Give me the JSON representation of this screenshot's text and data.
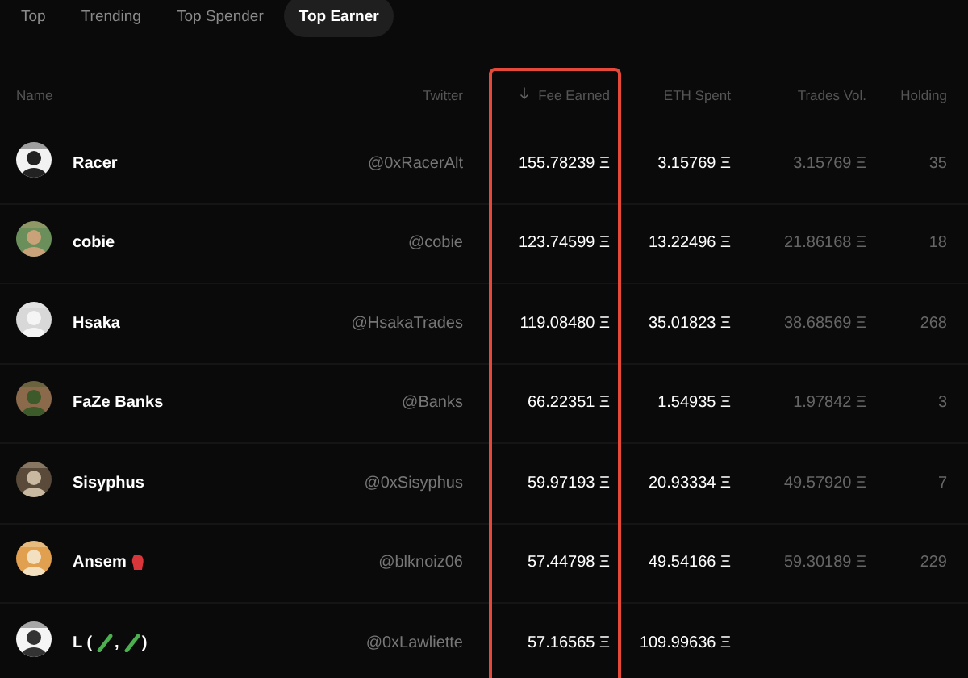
{
  "tabs": [
    {
      "label": "Top",
      "selected": false
    },
    {
      "label": "Trending",
      "selected": false
    },
    {
      "label": "Top Spender",
      "selected": false
    },
    {
      "label": "Top Earner",
      "selected": true
    }
  ],
  "table": {
    "columns": [
      {
        "label": "Name",
        "sorted": false
      },
      {
        "label": "Twitter",
        "sorted": false
      },
      {
        "label": "Fee Earned",
        "sorted": true
      },
      {
        "label": "ETH Spent",
        "sorted": false
      },
      {
        "label": "Trades Vol.",
        "sorted": false
      },
      {
        "label": "Holding",
        "sorted": false
      }
    ],
    "rows": [
      {
        "avatar": {
          "kind": "picture"
        },
        "name": [
          {
            "kind": "text",
            "text": "Racer"
          }
        ],
        "twitter": "@0xRacerAlt",
        "fee_earned": "155.78239 Ξ",
        "eth_spent": "3.15769 Ξ",
        "trades_vol": "3.15769 Ξ",
        "holding": "35"
      },
      {
        "avatar": {
          "kind": "picture"
        },
        "name": [
          {
            "kind": "text",
            "text": "cobie"
          }
        ],
        "twitter": "@cobie",
        "fee_earned": "123.74599 Ξ",
        "eth_spent": "13.22496 Ξ",
        "trades_vol": "21.86168 Ξ",
        "holding": "18"
      },
      {
        "avatar": {
          "kind": "picture"
        },
        "name": [
          {
            "kind": "text",
            "text": "Hsaka"
          }
        ],
        "twitter": "@HsakaTrades",
        "fee_earned": "119.08480 Ξ",
        "eth_spent": "35.01823 Ξ",
        "trades_vol": "38.68569 Ξ",
        "holding": "268"
      },
      {
        "avatar": {
          "kind": "picture"
        },
        "name": [
          {
            "kind": "text",
            "text": "FaZe Banks"
          }
        ],
        "twitter": "@Banks",
        "fee_earned": "66.22351 Ξ",
        "eth_spent": "1.54935 Ξ",
        "trades_vol": "1.97842 Ξ",
        "holding": "3"
      },
      {
        "avatar": {
          "kind": "picture"
        },
        "name": [
          {
            "kind": "text",
            "text": "Sisyphus"
          }
        ],
        "twitter": "@0xSisyphus",
        "fee_earned": "59.97193 Ξ",
        "eth_spent": "20.93334 Ξ",
        "trades_vol": "49.57920 Ξ",
        "holding": "7"
      },
      {
        "avatar": {
          "kind": "picture"
        },
        "name": [
          {
            "kind": "text",
            "text": "Ansem"
          },
          {
            "kind": "glove"
          }
        ],
        "twitter": "@blknoiz06",
        "fee_earned": "57.44798 Ξ",
        "eth_spent": "49.54166 Ξ",
        "trades_vol": "59.30189 Ξ",
        "holding": "229"
      },
      {
        "avatar": {
          "kind": "picture"
        },
        "name": [
          {
            "kind": "text",
            "text": "L ("
          },
          {
            "kind": "stick"
          },
          {
            "kind": "text",
            "text": ","
          },
          {
            "kind": "stick"
          },
          {
            "kind": "text",
            "text": ")"
          }
        ],
        "twitter": "@0xLawliette",
        "fee_earned": "57.16565 Ξ",
        "eth_spent": "109.99636 Ξ"
      }
    ]
  }
}
